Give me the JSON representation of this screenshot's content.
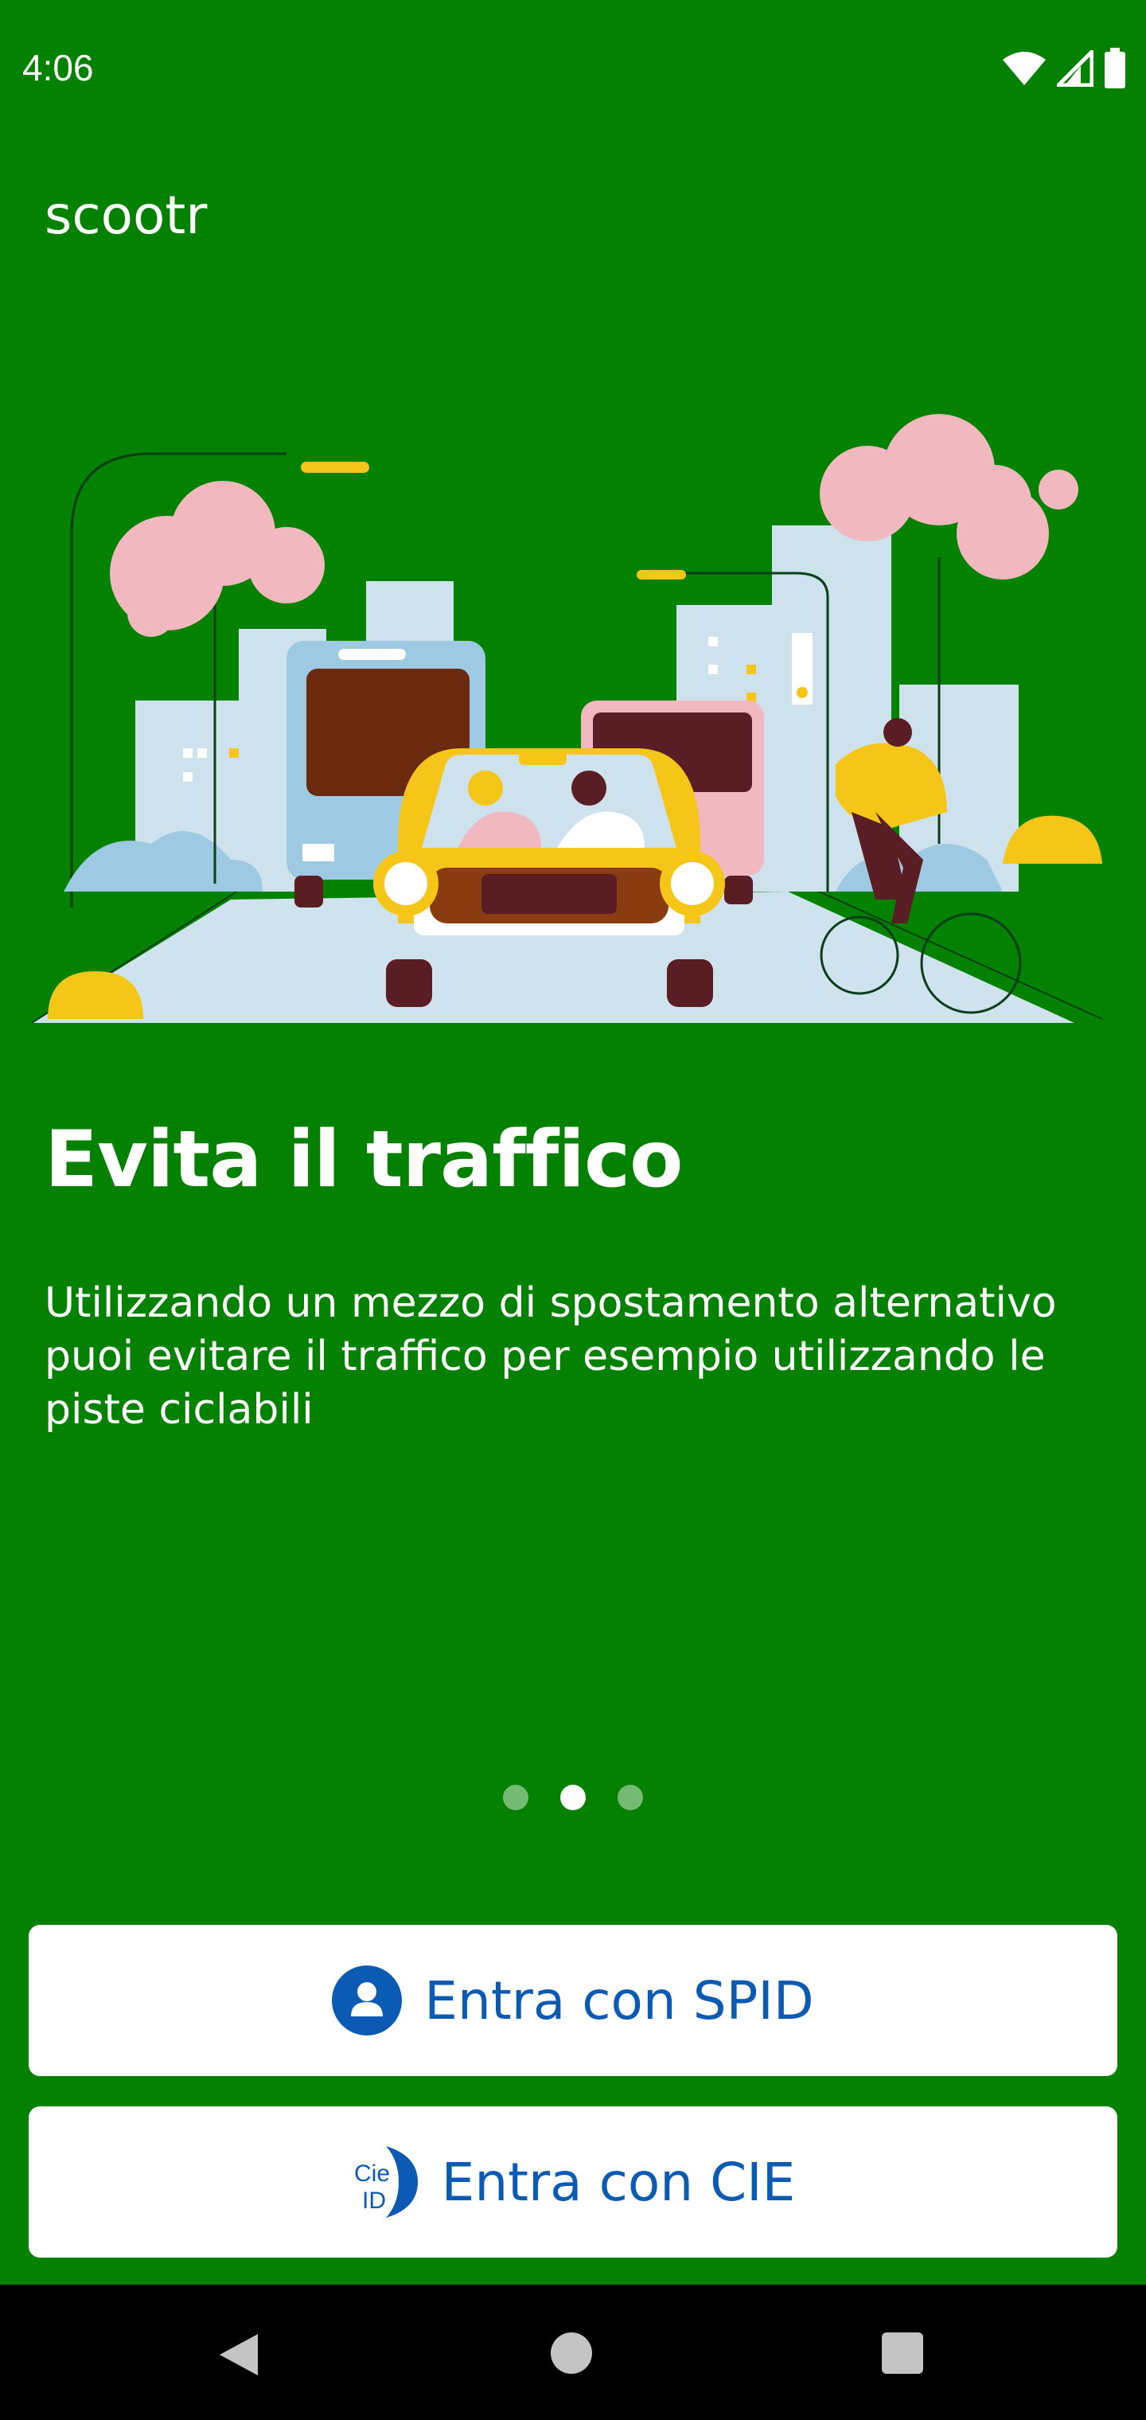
{
  "status_bar": {
    "time": "4:06",
    "icons": [
      "wifi-icon",
      "signal-icon",
      "battery-icon"
    ]
  },
  "app": {
    "title": "scootr"
  },
  "onboarding": {
    "headline": "Evita il traffico",
    "description": "Utilizzando un mezzo di spostamento alternativo puoi evitare il traffico per esempio utilizzando le piste ciclabili",
    "pager": {
      "total": 3,
      "active_index": 1
    }
  },
  "buttons": {
    "spid_label": "Entra con SPID",
    "cie_label": "Entra con CIE",
    "cie_icon_text_top": "Cie",
    "cie_icon_text_bottom": "ID"
  },
  "colors": {
    "background": "#058100",
    "button_text": "#0B5BB5",
    "button_bg": "#FFFFFF"
  }
}
